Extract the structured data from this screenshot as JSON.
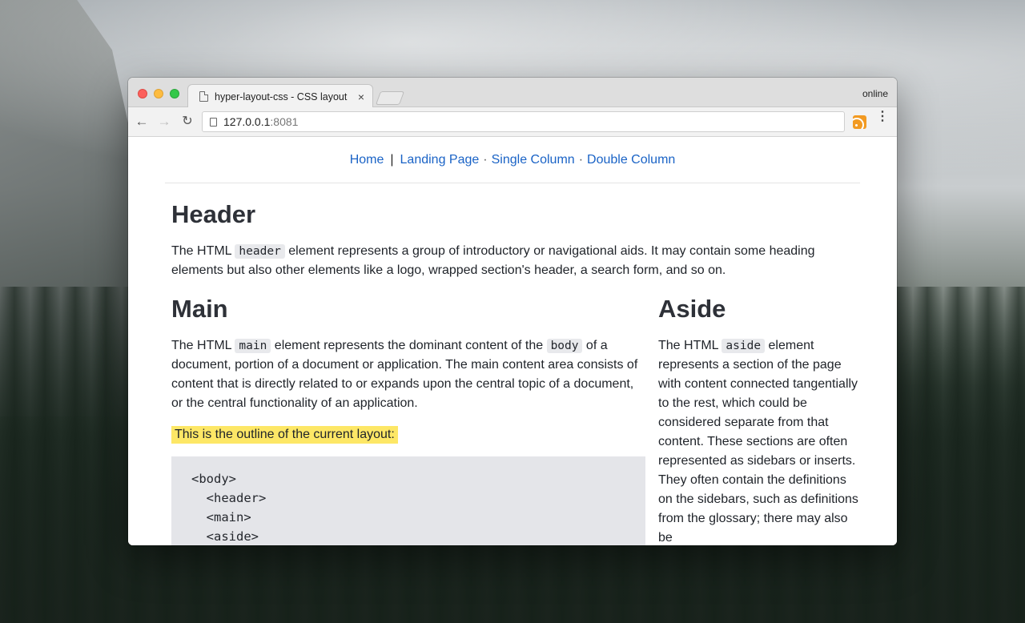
{
  "browser": {
    "tab_title": "hyper-layout-css - CSS layout",
    "tab_close": "×",
    "status": "online",
    "url_host": "127.0.0.1",
    "url_port": ":8081",
    "back_glyph": "←",
    "forward_glyph": "→",
    "reload_glyph": "↻",
    "menu_glyph": "⋮"
  },
  "nav": {
    "home": "Home",
    "separator": "|",
    "landing": "Landing Page",
    "dot": "·",
    "single": "Single Column",
    "double": "Double Column"
  },
  "header_section": {
    "title": "Header",
    "text_before": "The HTML ",
    "code": "header",
    "text_after": " element represents a group of introductory or navigational aids. It may contain some heading elements but also other elements like a logo, wrapped section's header, a search form, and so on."
  },
  "main_section": {
    "title": "Main",
    "text_1": "The HTML ",
    "code_1": "main",
    "text_2": " element represents the dominant content of the ",
    "code_2": "body",
    "text_3": " of a document, portion of a document or application. The main content area consists of content that is directly related to or expands upon the central topic of a document, or the central functionality of an application.",
    "highlight": "This is the outline of the current layout:",
    "outline": [
      "<body>",
      "  <header>",
      "  <main>",
      "  <aside>"
    ]
  },
  "aside_section": {
    "title": "Aside",
    "text_before": "The HTML ",
    "code": "aside",
    "text_after": " element represents a section of the page with content connected tangentially to the rest, which could be considered separate from that content. These sections are often represented as sidebars or inserts. They often contain the definitions on the sidebars, such as definitions from the glossary; there may also be"
  },
  "icons": {
    "tab": "document-icon",
    "rss": "rss-icon",
    "menu": "more-vert-icon"
  },
  "colors": {
    "link": "#1a63c6",
    "highlight": "#fde766",
    "code_bg": "#e8e9ec",
    "rss": "#f29a22"
  }
}
